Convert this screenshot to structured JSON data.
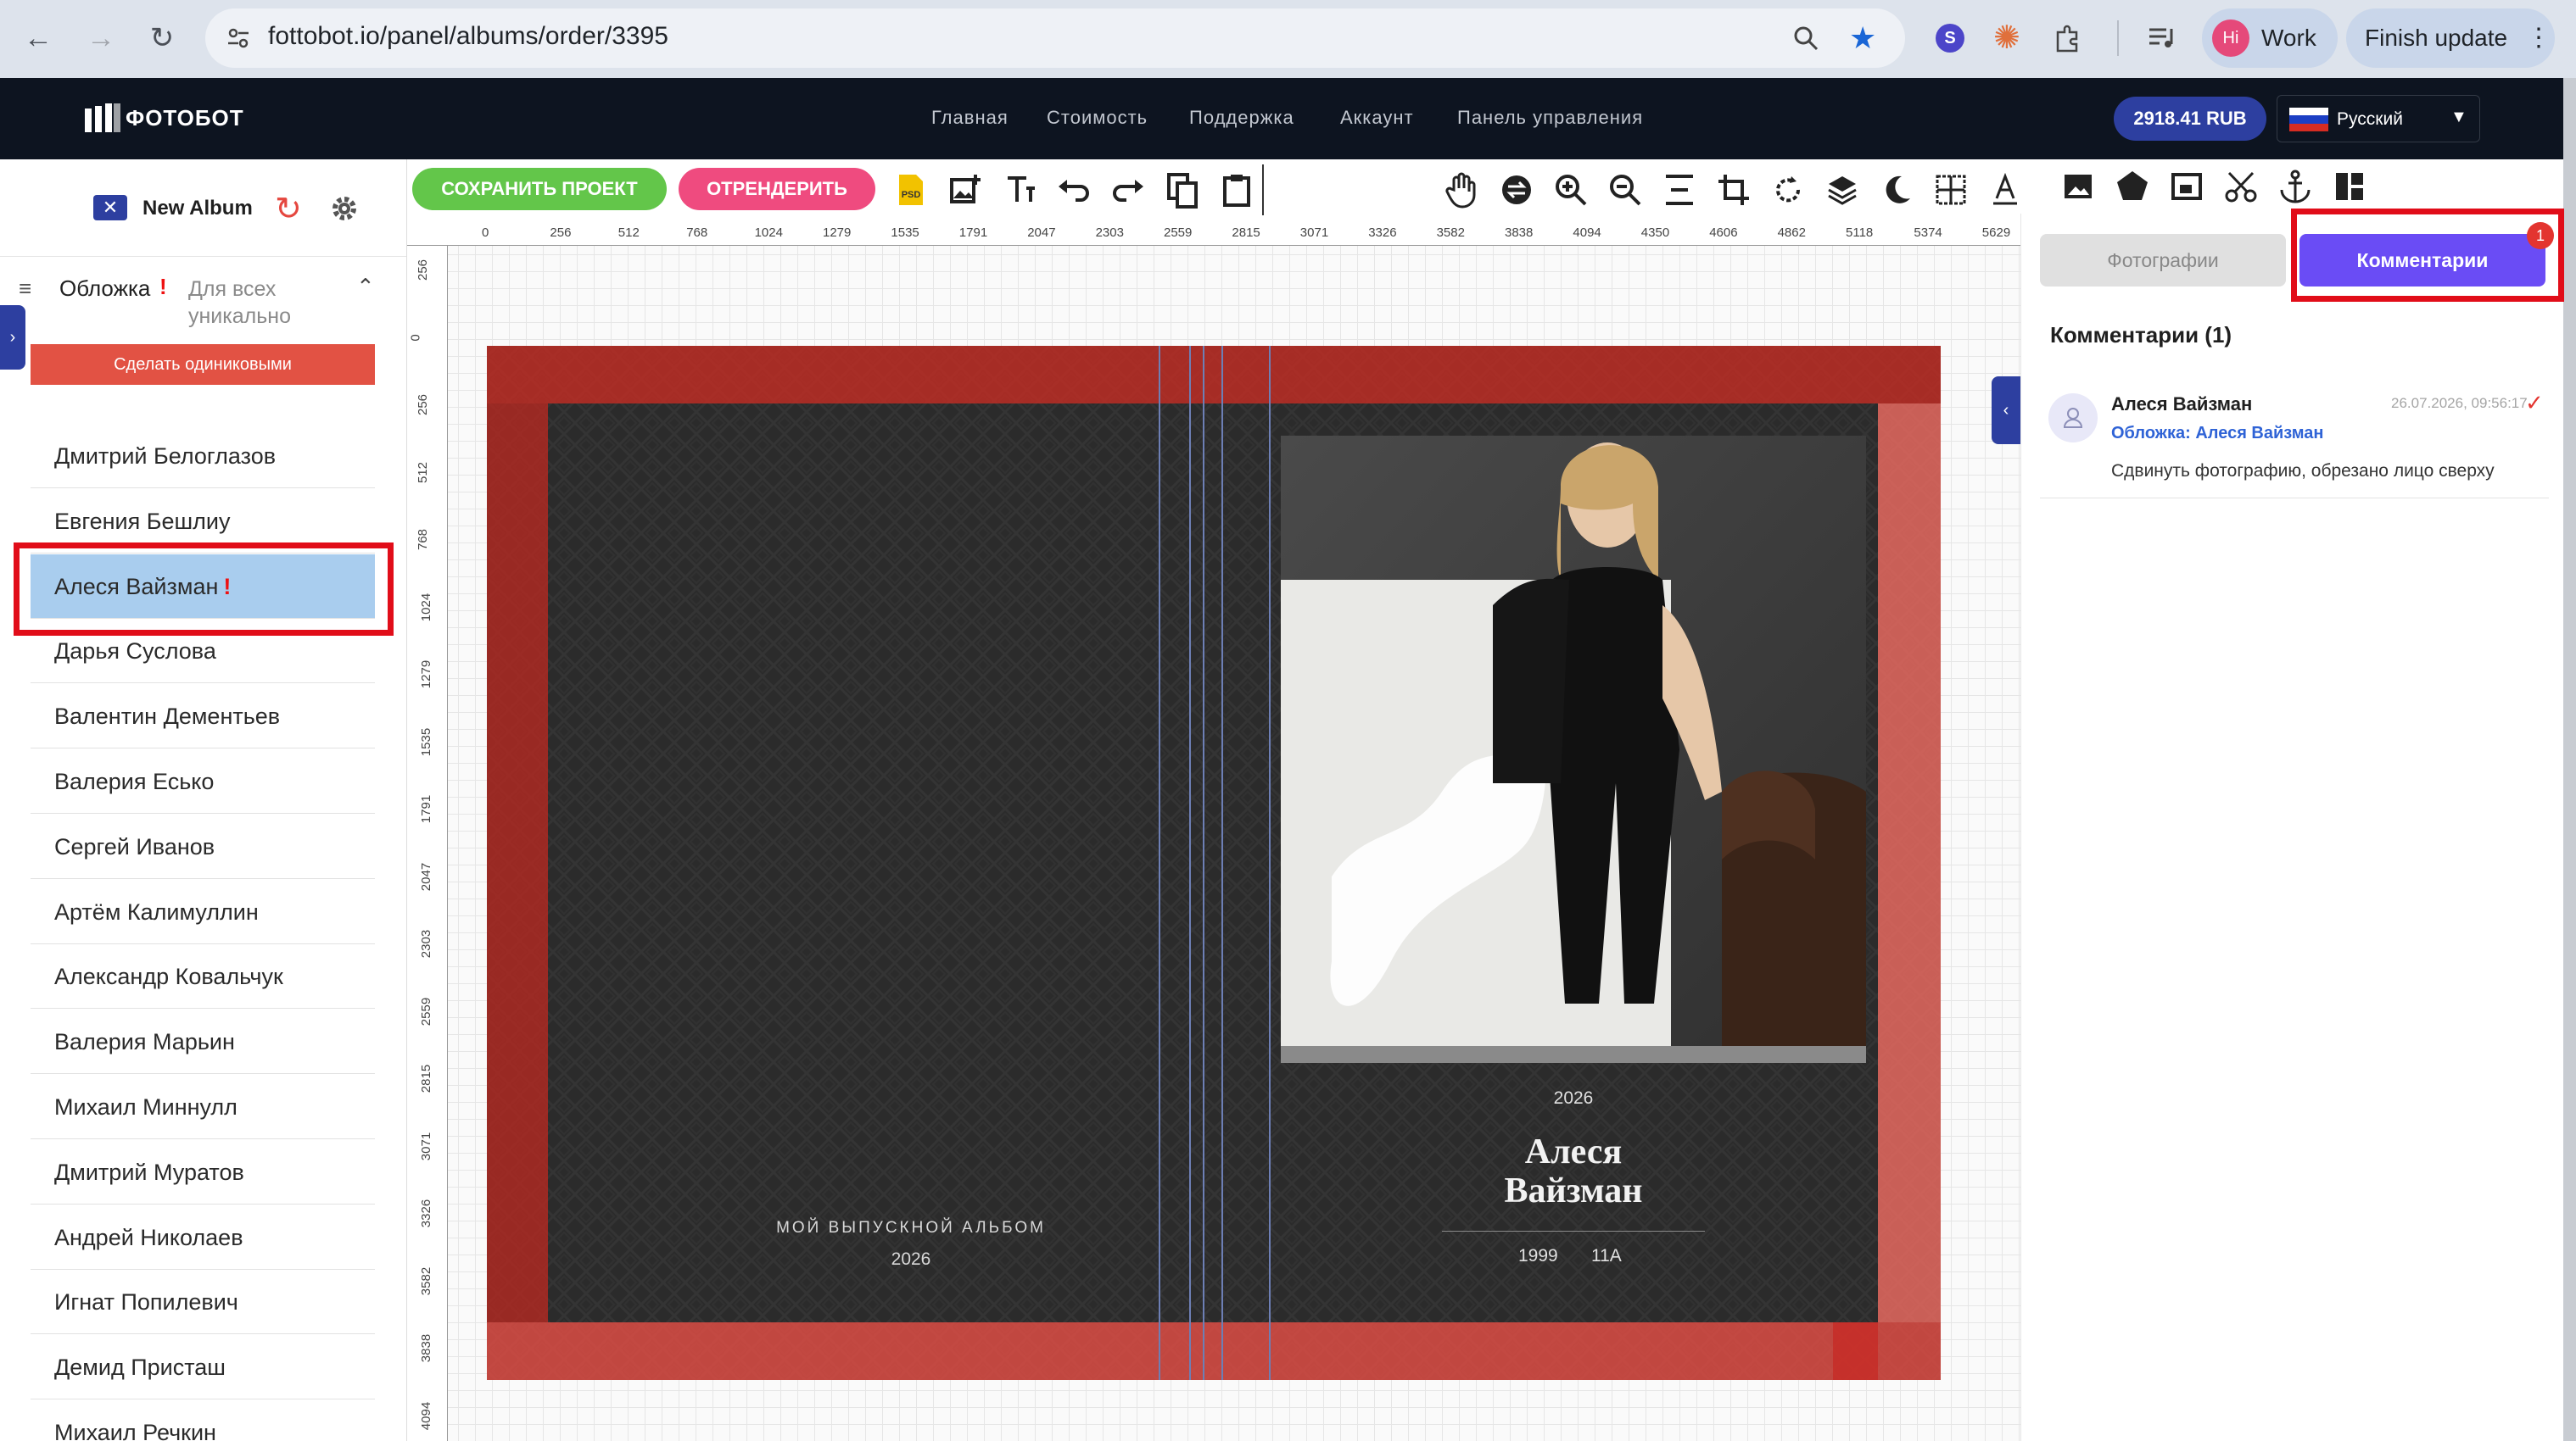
{
  "browser": {
    "url": "fottobot.io/panel/albums/order/3395",
    "profile_initials": "Hi",
    "profile_label": "Work",
    "finish_update": "Finish update",
    "ext_s": "S"
  },
  "nav": {
    "logo": "ФОТОБОТ",
    "links": [
      "Главная",
      "Стоимость",
      "Поддержка",
      "Аккаунт",
      "Панель управления"
    ],
    "balance": "2918.41 RUB",
    "language": "Русский"
  },
  "album": {
    "name": "New Album"
  },
  "sidebar": {
    "cover_label": "Обложка",
    "cover_mark": "!",
    "cover_sub": "Для всех уникально",
    "make_same": "Сделать одиниковыми",
    "people": [
      "Дмитрий Белоглазов",
      "Евгения Бешлиу",
      "Алеся Вайзман",
      "Дарья Суслова",
      "Валентин Дементьев",
      "Валерия Есько",
      "Сергей Иванов",
      "Артём Калимуллин",
      "Александр Ковальчук",
      "Валерия Марьин",
      "Михаил Миннулл",
      "Дмитрий Муратов",
      "Андрей Николаев",
      "Игнат Попилевич",
      "Демид Присташ",
      "Михаил Речкин"
    ],
    "selected_mark": "!"
  },
  "toolbar": {
    "save": "СОХРАНИТЬ ПРОЕКТ",
    "render": "ОТРЕНДЕРИТЬ",
    "psd": "PSD"
  },
  "ruler": {
    "h": [
      "0",
      "256",
      "512",
      "768",
      "1024",
      "1279",
      "1535",
      "1791",
      "2047",
      "2303",
      "2559",
      "2815",
      "3071",
      "3326",
      "3582",
      "3838",
      "4094",
      "4350",
      "4606",
      "4862",
      "5118",
      "5374",
      "5629"
    ],
    "v": [
      "256",
      "0",
      "256",
      "512",
      "768",
      "1024",
      "1279",
      "1535",
      "1791",
      "2047",
      "2303",
      "2559",
      "2815",
      "3071",
      "3326",
      "3582",
      "3838",
      "4094"
    ]
  },
  "cover": {
    "left_caption": "МОЙ ВЫПУСКНОЙ АЛЬБОМ",
    "left_year": "2026",
    "right_year": "2026",
    "name_line1": "Алеся",
    "name_line2": "Вайзман",
    "birth_year": "1999",
    "class": "11А"
  },
  "panel": {
    "tab_photos": "Фотографии",
    "tab_comments": "Комментарии",
    "badge": "1",
    "comments_title": "Комментарии (1)",
    "comment": {
      "author": "Алеся Вайзман",
      "date": "26.07.2026, 09:56:17",
      "target": "Обложка: Алеся Вайзман",
      "text": "Сдвинуть фотографию, обрезано лицо сверху"
    }
  },
  "colors": {
    "accent": "#6a4cf5",
    "save_green": "#63c64a",
    "render_pink": "#ef4b7f",
    "highlight_red": "#e10d19",
    "bleed_red": "#d62c22",
    "selected_bg": "#a9cdee"
  }
}
